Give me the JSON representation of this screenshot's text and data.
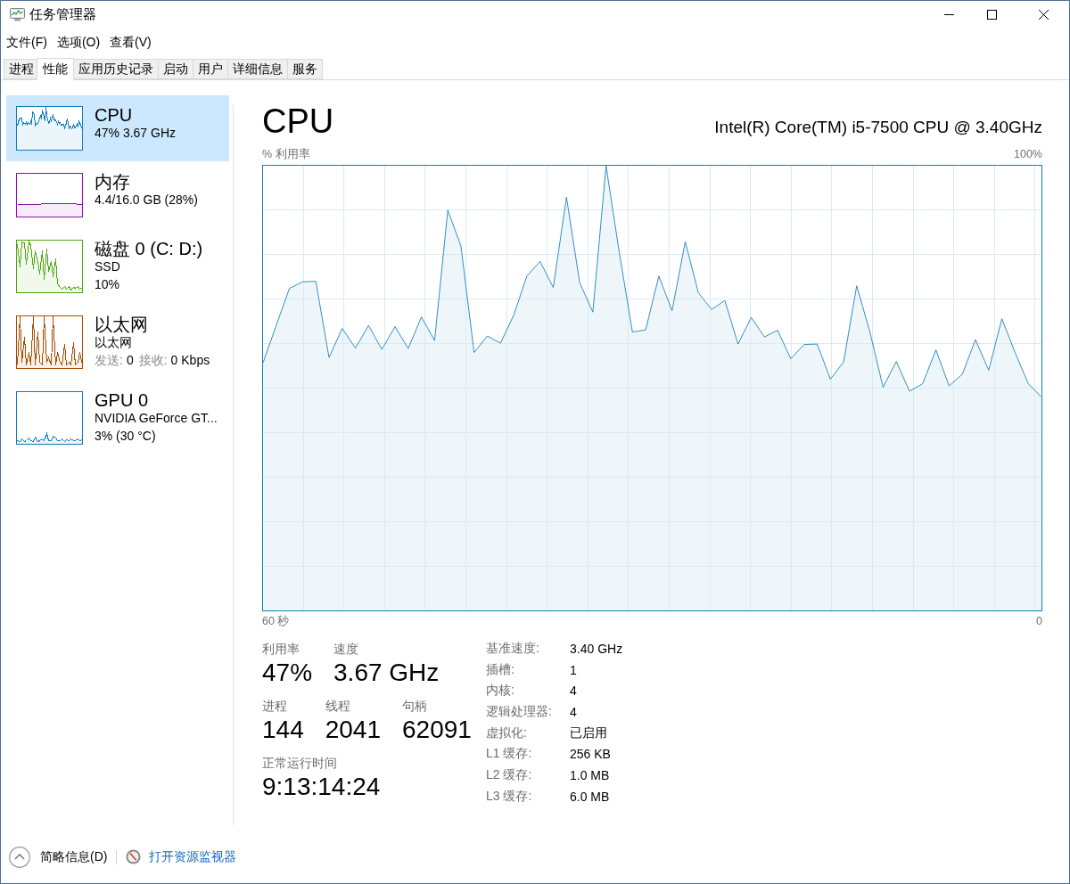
{
  "window": {
    "title": "任务管理器"
  },
  "menu": [
    "文件(F)",
    "选项(O)",
    "查看(V)"
  ],
  "tabs": [
    {
      "label": "进程",
      "selected": false
    },
    {
      "label": "性能",
      "selected": true
    },
    {
      "label": "应用历史记录",
      "selected": false
    },
    {
      "label": "启动",
      "selected": false
    },
    {
      "label": "用户",
      "selected": false
    },
    {
      "label": "详细信息",
      "selected": false
    },
    {
      "label": "服务",
      "selected": false
    }
  ],
  "sidebar": {
    "items": [
      {
        "title": "CPU",
        "selected": true,
        "color": "#117dbb",
        "lines": [
          {
            "text": "47% 3.67 GHz"
          }
        ]
      },
      {
        "title": "内存",
        "selected": false,
        "color": "#8b12ae",
        "lines": [
          {
            "text": "4.4/16.0 GB (28%)"
          }
        ]
      },
      {
        "title": "磁盘 0 (C: D:)",
        "selected": false,
        "color": "#4da60c",
        "lines": [
          {
            "text": "SSD"
          },
          {
            "text": "10%"
          }
        ]
      },
      {
        "title": "以太网",
        "selected": false,
        "color": "#a74f01",
        "lines": [
          {
            "text": "以太网"
          },
          {
            "pairs": [
              {
                "label": "发送:",
                "value": "0"
              },
              {
                "label": "接收:",
                "value": "0 Kbps"
              }
            ]
          }
        ]
      },
      {
        "title": "GPU 0",
        "selected": false,
        "color": "#117dbb",
        "lines": [
          {
            "text": "NVIDIA GeForce GT..."
          },
          {
            "text": "3% (30 °C)"
          }
        ]
      }
    ]
  },
  "performance": {
    "title": "CPU",
    "processor": "Intel(R) Core(TM) i5-7500 CPU @ 3.40GHz",
    "chart": {
      "ylabel": "% 利用率",
      "ymax": "100%",
      "x_start": "60 秒",
      "x_end": "0"
    },
    "stat_rows": [
      {
        "stats": [
          {
            "label": "利用率",
            "value": "47%"
          },
          {
            "label": "速度",
            "value": "3.67 GHz"
          }
        ]
      },
      {
        "stats": [
          {
            "label": "进程",
            "value": "144"
          },
          {
            "label": "线程",
            "value": "2041"
          },
          {
            "label": "句柄",
            "value": "62091"
          }
        ]
      },
      {
        "stats": [
          {
            "label": "正常运行时间",
            "value": "9:13:14:24"
          }
        ]
      }
    ],
    "specs": [
      {
        "label": "基准速度:",
        "value": "3.40 GHz"
      },
      {
        "label": "插槽:",
        "value": "1"
      },
      {
        "label": "内核:",
        "value": "4"
      },
      {
        "label": "逻辑处理器:",
        "value": "4"
      },
      {
        "label": "虚拟化:",
        "value": "已启用"
      },
      {
        "label": "L1 缓存:",
        "value": "256 KB"
      },
      {
        "label": "L2 缓存:",
        "value": "1.0 MB"
      },
      {
        "label": "L3 缓存:",
        "value": "6.0 MB"
      }
    ]
  },
  "footer": {
    "details_button": "简略信息(D)",
    "monitor_link": "打开资源监视器"
  }
}
